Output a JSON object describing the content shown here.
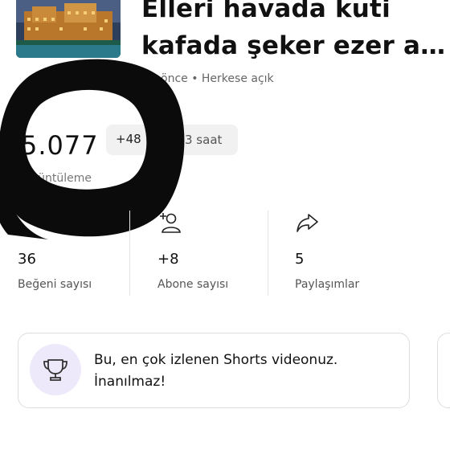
{
  "video": {
    "title_line1": "Elleri havada kuti",
    "title_line2": "kafada şeker ezer a…",
    "meta": "önce • Herkese açık"
  },
  "views": {
    "value": "5.077",
    "label": "Görüntüleme",
    "delta": "+48",
    "delta_period": "3 saat"
  },
  "stats": [
    {
      "icon": "none",
      "value": "36",
      "label": "Beğeni sayısı"
    },
    {
      "icon": "add-subscriber-icon",
      "value": "+8",
      "label": "Abone sayısı"
    },
    {
      "icon": "share-icon",
      "value": "5",
      "label": "Paylaşımlar"
    }
  ],
  "callout": {
    "icon": "trophy-icon",
    "text_line1": "Bu, en çok izlenen Shorts videonuz.",
    "text_line2": "İnanılmaz!"
  },
  "colors": {
    "accent_badge": "#ede9fb",
    "chip_bg": "#f1f1f1",
    "scribble": "#0b0b0b"
  }
}
